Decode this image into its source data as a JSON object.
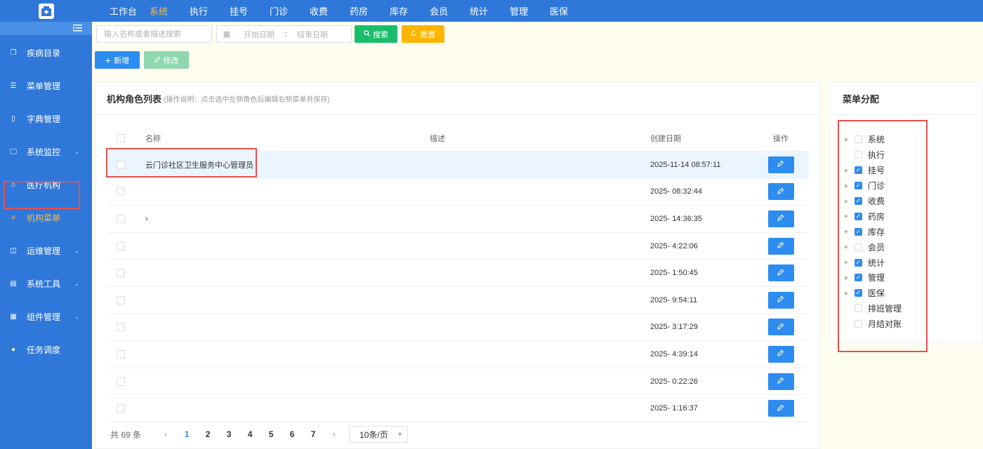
{
  "topnav": {
    "items": [
      "工作台",
      "系统",
      "执行",
      "挂号",
      "门诊",
      "收费",
      "药房",
      "库存",
      "会员",
      "统计",
      "管理",
      "医保"
    ],
    "active_index": 1
  },
  "sidebar": {
    "items": [
      {
        "label": "疾病目录",
        "icon": "copy-icon",
        "has_arrow": false
      },
      {
        "label": "菜单管理",
        "icon": "menu-icon",
        "has_arrow": false
      },
      {
        "label": "字典管理",
        "icon": "dictionary-icon",
        "has_arrow": false
      },
      {
        "label": "系统监控",
        "icon": "monitor-icon",
        "has_arrow": true
      },
      {
        "label": "医疗机构",
        "icon": "hospital-icon",
        "has_arrow": false
      },
      {
        "label": "机构菜单",
        "icon": "list-icon",
        "has_arrow": false
      },
      {
        "label": "运维管理",
        "icon": "operations-icon",
        "has_arrow": true
      },
      {
        "label": "系统工具",
        "icon": "toolbox-icon",
        "has_arrow": true
      },
      {
        "label": "组件管理",
        "icon": "grid-icon",
        "has_arrow": true
      },
      {
        "label": "任务调度",
        "icon": "clock-icon",
        "has_arrow": false
      }
    ],
    "active_index": 5
  },
  "toolbar": {
    "search_placeholder": "输入名称或者描述搜索",
    "date_start_placeholder": "开始日期",
    "date_separator": ":",
    "date_end_placeholder": "结束日期",
    "search_label": "搜索",
    "reset_label": "重置",
    "add_label": "新增",
    "edit_label": "修改"
  },
  "panel": {
    "title": "机构角色列表",
    "hint": "(操作说明：点击选中左侧角色后编辑右侧菜单并保存)",
    "columns": {
      "name": "名称",
      "desc": "描述",
      "date": "创建日期",
      "op": "操作"
    },
    "rows": [
      {
        "name": "云门诊社区卫生服务中心管理员",
        "desc": "",
        "date": "2025-11-14 08:57:11",
        "selected": true
      },
      {
        "name": "",
        "desc": "",
        "date": "2025-  08:32:44",
        "selected": false
      },
      {
        "name": "›",
        "desc": "",
        "date": "2025-  14:36:35",
        "selected": false
      },
      {
        "name": "",
        "desc": "",
        "date": "2025-  4:22:06",
        "selected": false
      },
      {
        "name": "",
        "desc": "",
        "date": "2025-  1:50:45",
        "selected": false
      },
      {
        "name": "",
        "desc": "",
        "date": "2025-  9:54:11",
        "selected": false
      },
      {
        "name": "",
        "desc": "",
        "date": "2025-  3:17:29",
        "selected": false
      },
      {
        "name": "",
        "desc": "",
        "date": "2025-  4:39:14",
        "selected": false
      },
      {
        "name": "",
        "desc": "",
        "date": "2025-  0:22:26",
        "selected": false
      },
      {
        "name": "",
        "desc": "",
        "date": "2025-  1:16:37",
        "selected": false
      }
    ]
  },
  "pagination": {
    "total_label": "共 69 条",
    "pages": [
      "1",
      "2",
      "3",
      "4",
      "5",
      "6",
      "7"
    ],
    "current": "1",
    "page_size_label": "10条/页"
  },
  "menu_assign": {
    "title": "菜单分配",
    "nodes": [
      {
        "label": "系统",
        "checked": false,
        "expandable": true
      },
      {
        "label": "执行",
        "checked": false,
        "expandable": false
      },
      {
        "label": "挂号",
        "checked": true,
        "expandable": true
      },
      {
        "label": "门诊",
        "checked": true,
        "expandable": true
      },
      {
        "label": "收费",
        "checked": true,
        "expandable": true
      },
      {
        "label": "药房",
        "checked": true,
        "expandable": true
      },
      {
        "label": "库存",
        "checked": true,
        "expandable": true
      },
      {
        "label": "会员",
        "checked": false,
        "expandable": true
      },
      {
        "label": "统计",
        "checked": true,
        "expandable": true
      },
      {
        "label": "管理",
        "checked": true,
        "expandable": true
      },
      {
        "label": "医保",
        "checked": true,
        "expandable": true
      },
      {
        "label": "排班管理",
        "checked": false,
        "expandable": false
      },
      {
        "label": "月结对账",
        "checked": false,
        "expandable": false
      }
    ]
  },
  "colors": {
    "primary": "#2f78d9",
    "accent": "#f5b942",
    "success": "#19be6b",
    "warning": "#ffb400",
    "button_blue": "#2d8cf0",
    "highlight_border": "#e65050"
  }
}
